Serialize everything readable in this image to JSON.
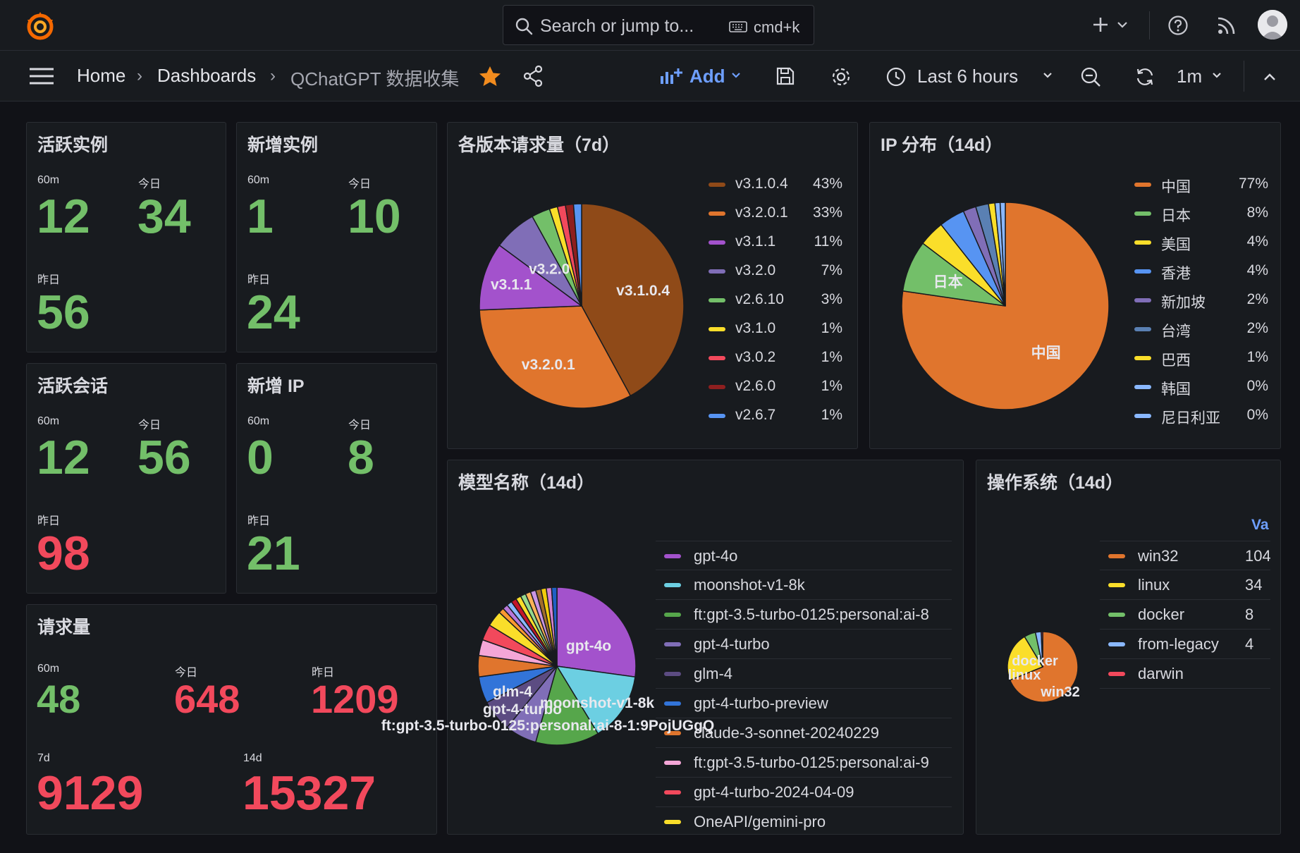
{
  "topbar": {
    "search_placeholder": "Search or jump to...",
    "search_shortcut": "cmd+k",
    "icons": [
      "grafana-logo-icon",
      "search-icon",
      "keyboard-icon",
      "plus-icon",
      "chevron-down-icon",
      "help-icon",
      "rss-icon",
      "avatar"
    ]
  },
  "breadcrumb": {
    "home": "Home",
    "dashboards": "Dashboards",
    "current": "QChatGPT 数据收集"
  },
  "toolbar": {
    "add_label": "Add",
    "time_range": "Last 6 hours",
    "refresh_interval": "1m"
  },
  "stat_panels": {
    "active_instances": {
      "title": "活跃实例",
      "m60_label": "60m",
      "m60": "12",
      "today_label": "今日",
      "today": "34",
      "yesterday_label": "昨日",
      "yesterday": "56"
    },
    "new_instances": {
      "title": "新增实例",
      "m60_label": "60m",
      "m60": "1",
      "today_label": "今日",
      "today": "10",
      "yesterday_label": "昨日",
      "yesterday": "24"
    },
    "active_sessions": {
      "title": "活跃会话",
      "m60_label": "60m",
      "m60": "12",
      "today_label": "今日",
      "today": "56",
      "yesterday_label": "昨日",
      "yesterday": "98"
    },
    "new_ip": {
      "title": "新增 IP",
      "m60_label": "60m",
      "m60": "0",
      "today_label": "今日",
      "today": "8",
      "yesterday_label": "昨日",
      "yesterday": "21"
    },
    "requests": {
      "title": "请求量",
      "m60_label": "60m",
      "m60": "48",
      "today_label": "今日",
      "today": "648",
      "yesterday_label": "昨日",
      "yesterday": "1209",
      "d7_label": "7d",
      "d7": "9129",
      "d14_label": "14d",
      "d14": "15327"
    }
  },
  "colors": {
    "green": "#73bf69",
    "red": "#f2495c",
    "accent_blue": "#6e9fff",
    "star": "#f28c1e"
  },
  "chart_data": [
    {
      "type": "pie",
      "title": "各版本请求量（7d）",
      "legend_placement": "right",
      "slices": [
        {
          "label": "v3.1.0.4",
          "value": 43,
          "display": "43%",
          "color": "#8f4a18"
        },
        {
          "label": "v3.2.0.1",
          "value": 33,
          "display": "33%",
          "color": "#e0752d"
        },
        {
          "label": "v3.1.1",
          "value": 11,
          "display": "11%",
          "color": "#a352cc"
        },
        {
          "label": "v3.2.0",
          "value": 7,
          "display": "7%",
          "color": "#806eb7"
        },
        {
          "label": "v2.6.10",
          "value": 3,
          "display": "3%",
          "color": "#73bf69"
        },
        {
          "label": "v3.1.0",
          "value": 1,
          "display": "1%",
          "color": "#fade2a"
        },
        {
          "label": "v3.0.2",
          "value": 1,
          "display": "1%",
          "color": "#f2495c"
        },
        {
          "label": "v2.6.0",
          "value": 1,
          "display": "1%",
          "color": "#8e1f1f"
        },
        {
          "label": "v2.6.7",
          "value": 1,
          "display": "1%",
          "color": "#5794f2"
        }
      ]
    },
    {
      "type": "pie",
      "title": "IP 分布（14d）",
      "legend_placement": "right",
      "slices": [
        {
          "label": "中国",
          "value": 77,
          "display": "77%",
          "color": "#e0752d"
        },
        {
          "label": "日本",
          "value": 8,
          "display": "8%",
          "color": "#73bf69"
        },
        {
          "label": "美国",
          "value": 4,
          "display": "4%",
          "color": "#fade2a"
        },
        {
          "label": "香港",
          "value": 4,
          "display": "4%",
          "color": "#5794f2"
        },
        {
          "label": "新加坡",
          "value": 2,
          "display": "2%",
          "color": "#806eb7"
        },
        {
          "label": "台湾",
          "value": 2,
          "display": "2%",
          "color": "#5a80b3"
        },
        {
          "label": "巴西",
          "value": 1,
          "display": "1%",
          "color": "#fade2a"
        },
        {
          "label": "韩国",
          "value": 0,
          "display": "0%",
          "color": "#8ab8ff"
        },
        {
          "label": "尼日利亚",
          "value": 0,
          "display": "0%",
          "color": "#8ab8ff"
        }
      ]
    },
    {
      "type": "pie",
      "title": "模型名称（14d）",
      "legend_placement": "right",
      "visible_slice_labels": [
        "gpt-4o",
        "moonshot-v1-8k",
        "ft:gpt-3.5-turbo-0125:personal:ai-8-1:9PojUGgQ",
        "gpt-4-turbo",
        "glm-4"
      ],
      "slices": [
        {
          "label": "gpt-4o",
          "value": 25,
          "color": "#a352cc"
        },
        {
          "label": "moonshot-v1-8k",
          "value": 13,
          "color": "#6ccfe2"
        },
        {
          "label": "ft:gpt-3.5-turbo-0125:personal:ai-8",
          "value": 12,
          "color": "#56a64b"
        },
        {
          "label": "gpt-4-turbo",
          "value": 6,
          "color": "#806eb7"
        },
        {
          "label": "glm-4",
          "value": 6,
          "color": "#5c4c82"
        },
        {
          "label": "gpt-4-turbo-preview",
          "value": 5,
          "color": "#3274d9"
        },
        {
          "label": "claude-3-sonnet-20240229",
          "value": 4,
          "color": "#e0752d"
        },
        {
          "label": "ft:gpt-3.5-turbo-0125:personal:ai-9",
          "value": 3,
          "color": "#f4a6d7"
        },
        {
          "label": "gpt-4-turbo-2024-04-09",
          "value": 3,
          "color": "#f2495c"
        },
        {
          "label": "OneAPI/gemini-pro",
          "value": 3,
          "color": "#fade2a"
        }
      ]
    },
    {
      "type": "pie",
      "title": "操作系统（14d）",
      "legend_placement": "right",
      "value_header": "Va",
      "slices": [
        {
          "label": "win32",
          "value": 104,
          "display": "104",
          "color": "#e0752d"
        },
        {
          "label": "linux",
          "value": 34,
          "display": "34",
          "color": "#fade2a"
        },
        {
          "label": "docker",
          "value": 8,
          "display": "8",
          "color": "#73bf69"
        },
        {
          "label": "from-legacy",
          "value": 4,
          "display": "4",
          "color": "#8ab8ff"
        },
        {
          "label": "darwin",
          "value": 1,
          "display": "",
          "color": "#f2495c"
        }
      ]
    }
  ]
}
